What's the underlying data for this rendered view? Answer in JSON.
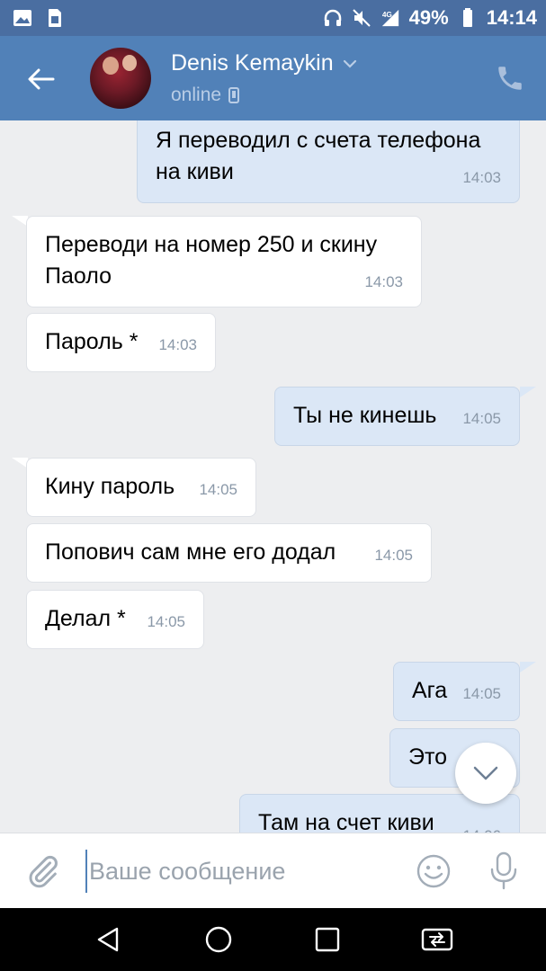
{
  "status_bar": {
    "battery_percent": "49%",
    "time": "14:14",
    "icons": [
      "image-icon",
      "sim-card-icon",
      "headphones-icon",
      "mute-icon",
      "signal-icon",
      "battery-icon"
    ]
  },
  "header": {
    "contact_name": "Denis Kemaykin",
    "status": "online",
    "icons": [
      "back-arrow-icon",
      "chevron-down-icon",
      "mobile-icon",
      "phone-icon"
    ],
    "accent_color": "#5181b8"
  },
  "messages": [
    {
      "direction": "out",
      "text": "Я переводил с счета телефона на киви",
      "time": "14:03"
    },
    {
      "direction": "in",
      "text": "Переводи на номер 250 и скину Паоло",
      "time": "14:03"
    },
    {
      "direction": "in",
      "text": "Пароль *",
      "time": "14:03"
    },
    {
      "direction": "out",
      "text": "Ты не кинешь",
      "time": "14:05"
    },
    {
      "direction": "in",
      "text": "Кину пароль",
      "time": "14:05"
    },
    {
      "direction": "in",
      "text": "Попович сам мне его додал",
      "time": "14:05"
    },
    {
      "direction": "in",
      "text": "Делал *",
      "time": "14:05"
    },
    {
      "direction": "out",
      "text": "Ага",
      "time": "14:05"
    },
    {
      "direction": "out",
      "text": "Это",
      "time": ""
    },
    {
      "direction": "out",
      "text": "Там на счет киви",
      "time": "14:06"
    }
  ],
  "composer": {
    "placeholder": "Ваше сообщение",
    "value": "",
    "icons": [
      "paperclip-icon",
      "emoji-icon",
      "microphone-icon"
    ]
  },
  "navbar": {
    "icons": [
      "back-triangle-icon",
      "home-circle-icon",
      "recents-square-icon",
      "switch-app-icon"
    ]
  }
}
